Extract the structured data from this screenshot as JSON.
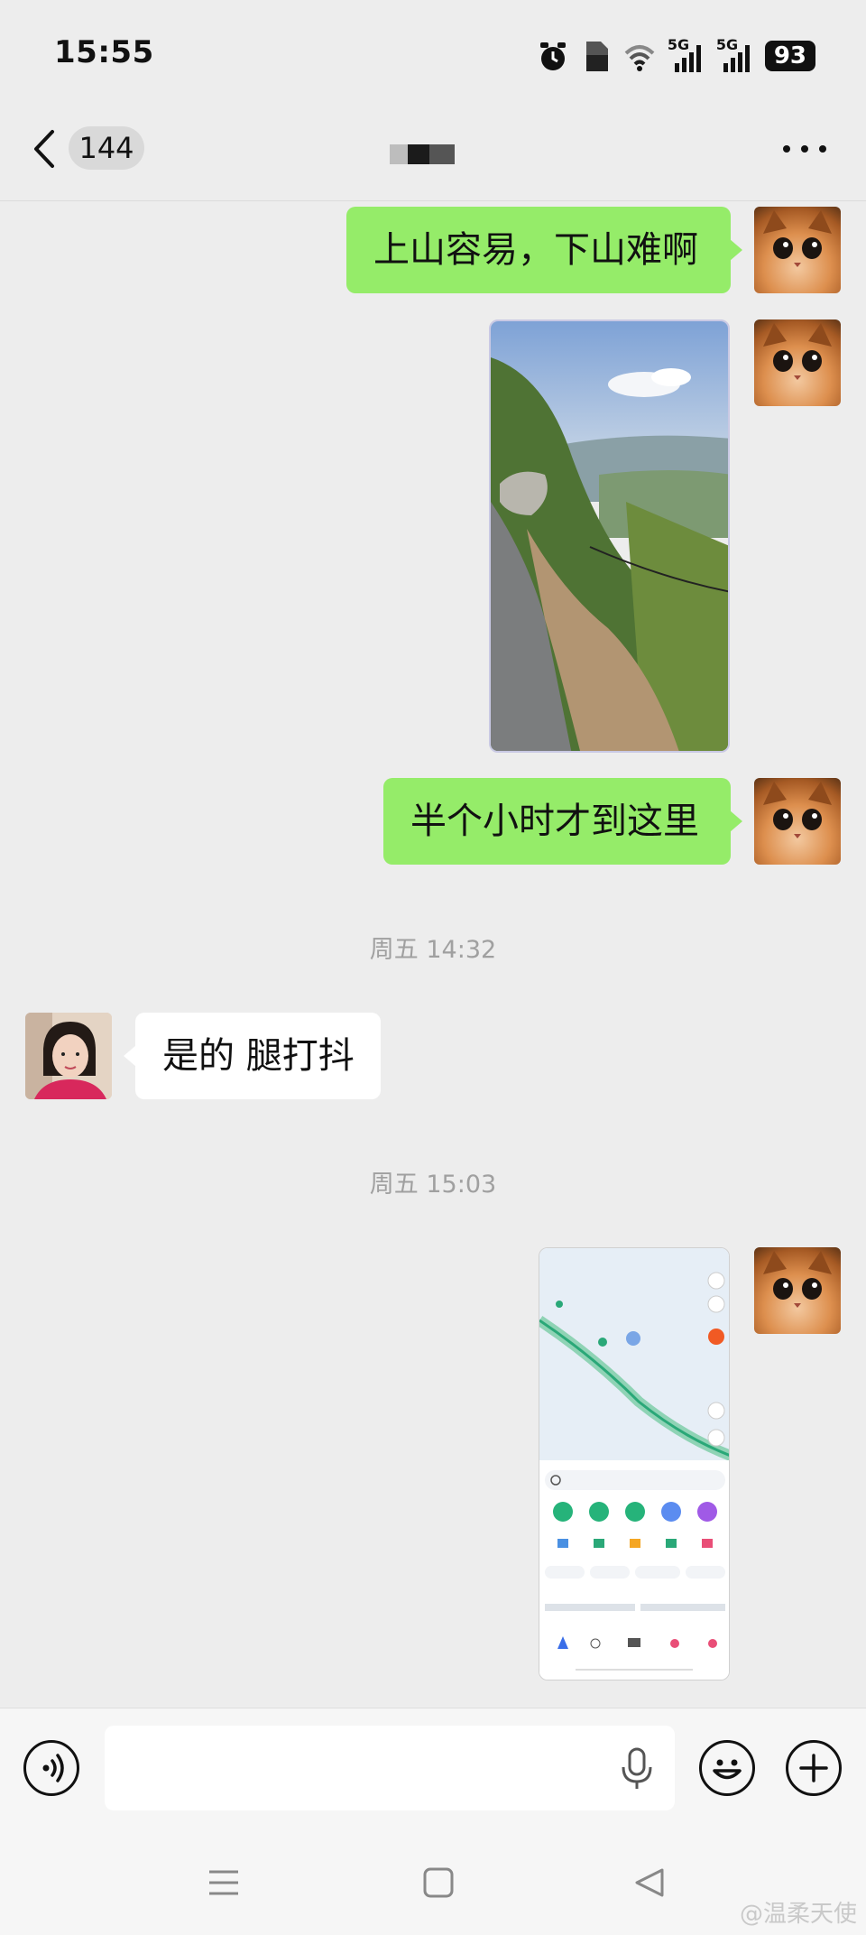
{
  "status_bar": {
    "time": "15:55",
    "battery": "93",
    "signal_1_label": "5G",
    "signal_2_label": "5G",
    "icons": [
      "alarm-icon",
      "sim-icon",
      "wifi-icon",
      "signal-5g-icon",
      "signal-5g-icon",
      "battery-icon"
    ]
  },
  "header": {
    "unread_count": "144",
    "back_icon": "chevron-left-icon",
    "more_icon": "more-dots-icon"
  },
  "messages": {
    "m1": {
      "text": "上山容易，下山难啊"
    },
    "m3": {
      "text": "半个小时才到这里"
    },
    "t1": {
      "text": "周五 14:32"
    },
    "m4": {
      "text": "是的 腿打抖"
    },
    "t2": {
      "text": "周五 15:03"
    }
  },
  "input_bar": {
    "voice_icon": "voice-icon",
    "mic_icon": "microphone-icon",
    "emoji_icon": "emoji-icon",
    "add_icon": "plus-icon"
  },
  "nav_bar": {
    "icons": [
      "menu-icon",
      "home-square-icon",
      "back-triangle-icon"
    ]
  },
  "watermark": "@温柔天使",
  "colors": {
    "background": "#ededed",
    "my_bubble": "#95ec69",
    "their_bubble": "#ffffff",
    "time_label": "#a0a0a0"
  }
}
